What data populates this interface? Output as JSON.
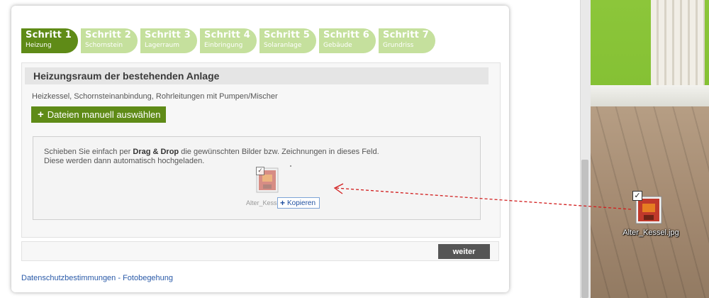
{
  "steps": [
    {
      "title": "Schritt 1",
      "subtitle": "Heizung",
      "active": true
    },
    {
      "title": "Schritt 2",
      "subtitle": "Schornstein",
      "active": false
    },
    {
      "title": "Schritt 3",
      "subtitle": "Lagerraum",
      "active": false
    },
    {
      "title": "Schritt 4",
      "subtitle": "Einbringung",
      "active": false
    },
    {
      "title": "Schritt 5",
      "subtitle": "Solaranlage",
      "active": false
    },
    {
      "title": "Schritt 6",
      "subtitle": "Gebäude",
      "active": false
    },
    {
      "title": "Schritt 7",
      "subtitle": "Grundriss",
      "active": false
    }
  ],
  "section": {
    "title": "Heizungsraum der bestehenden Anlage",
    "description": "Heizkessel, Schornsteinanbindung, Rohrleitungen mit Pumpen/Mischer"
  },
  "upload": {
    "select_button_label": "Dateien manuell auswählen",
    "dropzone_line1_prefix": "Schieben Sie einfach per ",
    "dropzone_line1_bold": "Drag & Drop",
    "dropzone_line1_suffix": " die gewünschten Bilder bzw. Zeichnungen in dieses Feld.",
    "dropzone_line2": "Diese werden dann automatisch hochgeladen.",
    "dragged_file_label": "Alter_Kesse",
    "copy_tooltip_label": "Kopieren"
  },
  "nav": {
    "next_label": "weiter"
  },
  "footer": {
    "privacy_link": "Datenschutzbestimmungen - Fotobegehung"
  },
  "desktop": {
    "file_label": "Alter_Kessel.jpg"
  },
  "colors": {
    "step_active": "#5f8b17",
    "step_inactive": "#c5e09d",
    "button_green": "#5f8b17",
    "button_dark": "#555555",
    "drag_arrow": "#d21f1f",
    "link": "#2a5aa8"
  },
  "icons": {
    "plus": "plus-icon",
    "checkbox": "checkbox-icon",
    "image_file": "image-file-icon",
    "arrow": "drag-arrow"
  }
}
